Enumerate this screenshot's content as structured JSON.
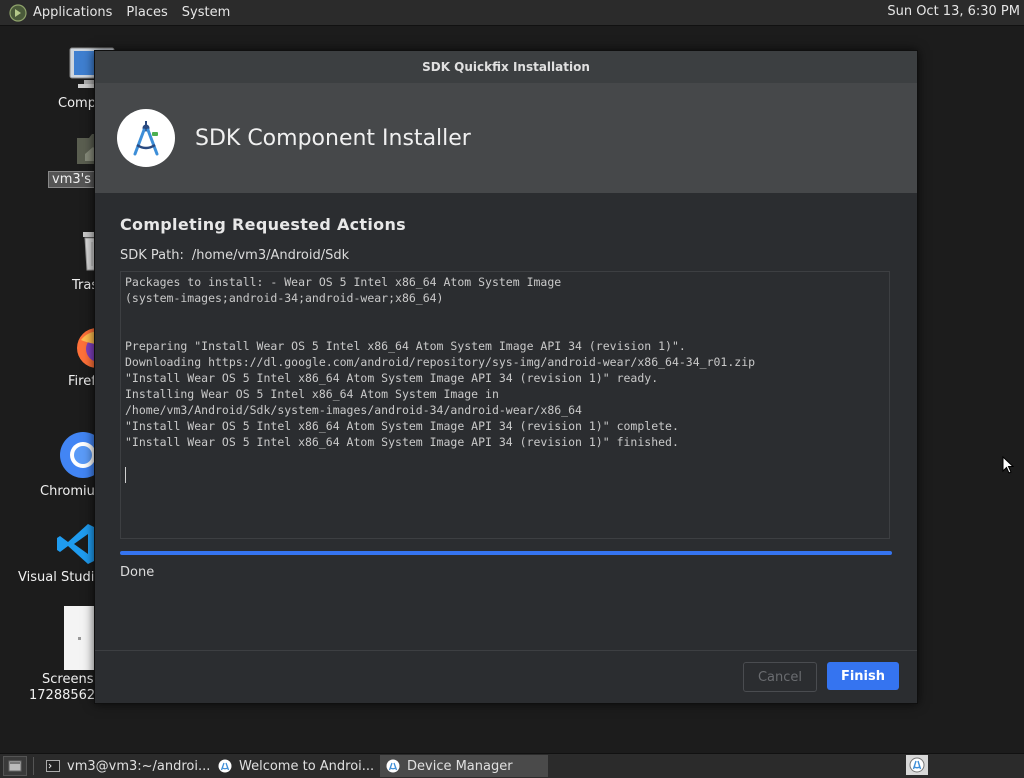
{
  "top_panel": {
    "menus": [
      "Applications",
      "Places",
      "System"
    ],
    "clock": "Sun Oct 13,  6:30 PM"
  },
  "desktop_icons": [
    {
      "label": "Comp"
    },
    {
      "label": "vm3's H"
    },
    {
      "label": "Tras"
    },
    {
      "label": "Firef"
    },
    {
      "label": "Chromiu"
    },
    {
      "label": "Visual Studio"
    },
    {
      "label": "Screensh",
      "label2": "172885622"
    }
  ],
  "dialog": {
    "window_title": "SDK Quickfix Installation",
    "header_title": "SDK Component Installer",
    "section_title": "Completing Requested Actions",
    "sdk_path_label": "SDK Path:",
    "sdk_path_value": "/home/vm3/Android/Sdk",
    "log_lines": [
      "Packages to install: - Wear OS 5 Intel x86_64 Atom System Image",
      "(system-images;android-34;android-wear;x86_64)",
      "",
      "",
      "Preparing \"Install Wear OS 5 Intel x86_64 Atom System Image API 34 (revision 1)\".",
      "Downloading https://dl.google.com/android/repository/sys-img/android-wear/x86_64-34_r01.zip",
      "\"Install Wear OS 5 Intel x86_64 Atom System Image API 34 (revision 1)\" ready.",
      "Installing Wear OS 5 Intel x86_64 Atom System Image in",
      "/home/vm3/Android/Sdk/system-images/android-34/android-wear/x86_64",
      "\"Install Wear OS 5 Intel x86_64 Atom System Image API 34 (revision 1)\" complete.",
      "\"Install Wear OS 5 Intel x86_64 Atom System Image API 34 (revision 1)\" finished.",
      ""
    ],
    "progress": 1.0,
    "status": "Done",
    "cancel_label": "Cancel",
    "finish_label": "Finish",
    "accent_color": "#3574f0"
  },
  "taskbar": {
    "tasks": [
      {
        "label": "vm3@vm3:~/androi...",
        "icon": "terminal-icon"
      },
      {
        "label": "Welcome to Androi...",
        "icon": "android-studio-icon"
      },
      {
        "label": "Device Manager",
        "icon": "android-studio-icon"
      }
    ]
  }
}
